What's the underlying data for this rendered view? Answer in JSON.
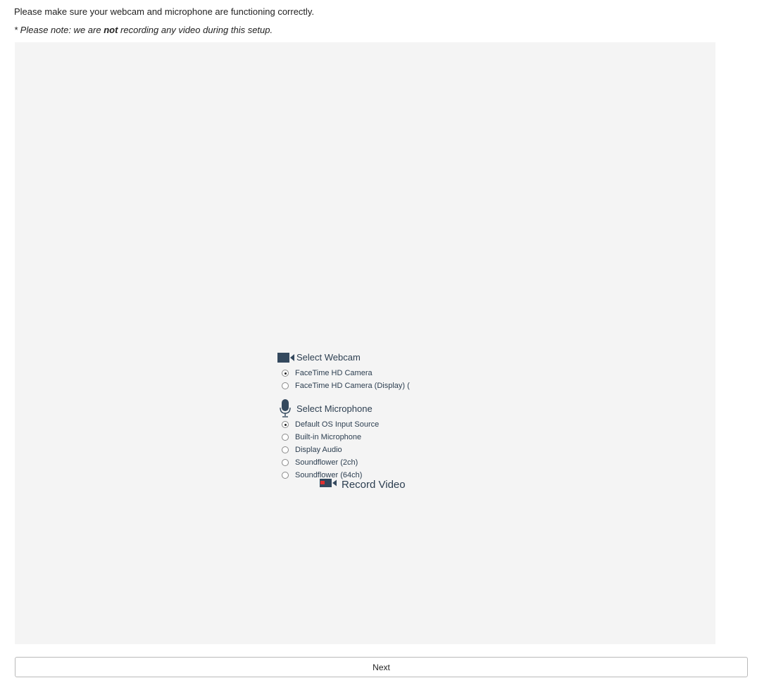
{
  "intro_text": "Please make sure your webcam and microphone are functioning correctly.",
  "note": {
    "prefix": "* Please note: we are ",
    "emphasis": "not",
    "suffix": " recording any video during this setup."
  },
  "webcam": {
    "heading": "Select Webcam",
    "icon": "video-camera-icon",
    "options": [
      {
        "label": "FaceTime HD Camera",
        "selected": true
      },
      {
        "label": "FaceTime HD Camera (Display) (",
        "selected": false
      }
    ]
  },
  "microphone": {
    "heading": "Select Microphone",
    "icon": "microphone-icon",
    "options": [
      {
        "label": "Default OS Input Source",
        "selected": true
      },
      {
        "label": "Built-in Microphone",
        "selected": false
      },
      {
        "label": "Display Audio",
        "selected": false
      },
      {
        "label": "Soundflower (2ch)",
        "selected": false
      },
      {
        "label": "Soundflower (64ch)",
        "selected": false
      }
    ]
  },
  "record": {
    "label": "Record Video",
    "icon": "record-video-icon"
  },
  "next_button": {
    "label": "Next"
  },
  "colors": {
    "panel_bg": "#f4f4f4",
    "icon": "#34495e",
    "record_dot": "#e03030"
  }
}
